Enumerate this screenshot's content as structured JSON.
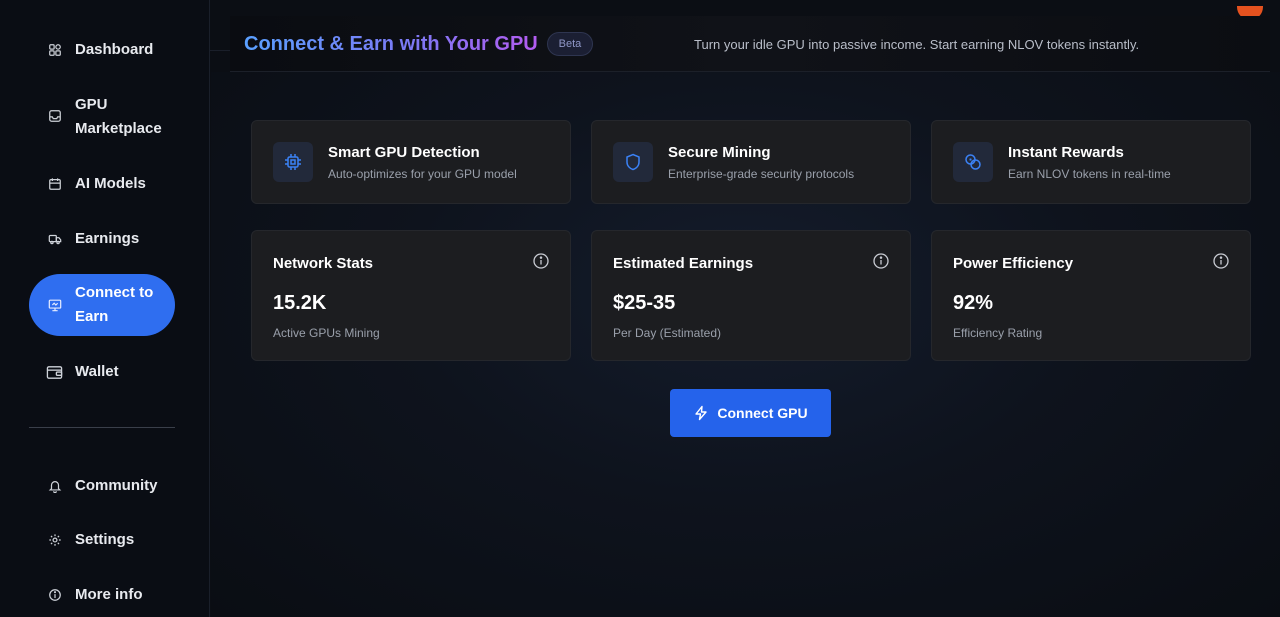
{
  "sidebar": {
    "items": [
      {
        "label": "Dashboard",
        "icon": "dashboard-grid-icon"
      },
      {
        "label": "GPU Marketplace",
        "icon": "storage-icon"
      },
      {
        "label": "AI Models",
        "icon": "calendar-icon"
      },
      {
        "label": "Earnings",
        "icon": "truck-icon"
      },
      {
        "label": "Connect to Earn",
        "icon": "monitor-icon",
        "active": true
      },
      {
        "label": "Wallet",
        "icon": "wallet-icon"
      },
      {
        "label": "Community",
        "icon": "bell-icon"
      },
      {
        "label": "Settings",
        "icon": "gear-icon"
      },
      {
        "label": "More info",
        "icon": "info-icon"
      }
    ]
  },
  "header": {
    "title": "Connect & Earn with Your GPU",
    "badge": "Beta",
    "subtitle": "Turn your idle GPU into passive income. Start earning NLOV tokens instantly."
  },
  "features": [
    {
      "title": "Smart GPU Detection",
      "description": "Auto-optimizes for your GPU model",
      "icon": "cpu-chip-icon"
    },
    {
      "title": "Secure Mining",
      "description": "Enterprise-grade security protocols",
      "icon": "shield-icon"
    },
    {
      "title": "Instant Rewards",
      "description": "Earn NLOV tokens in real-time",
      "icon": "coins-icon"
    }
  ],
  "stats": [
    {
      "title": "Network Stats",
      "value": "15.2K",
      "label": "Active GPUs Mining"
    },
    {
      "title": "Estimated Earnings",
      "value": "$25-35",
      "label": "Per Day (Estimated)"
    },
    {
      "title": "Power Efficiency",
      "value": "92%",
      "label": "Efficiency Rating"
    }
  ],
  "action": {
    "connect_label": "Connect GPU",
    "icon": "lightning-icon"
  },
  "colors": {
    "accent": "#2f6ef0",
    "button": "#2563eb",
    "card_bg": "#1c1d20",
    "icon_blue": "#3b82f6"
  }
}
